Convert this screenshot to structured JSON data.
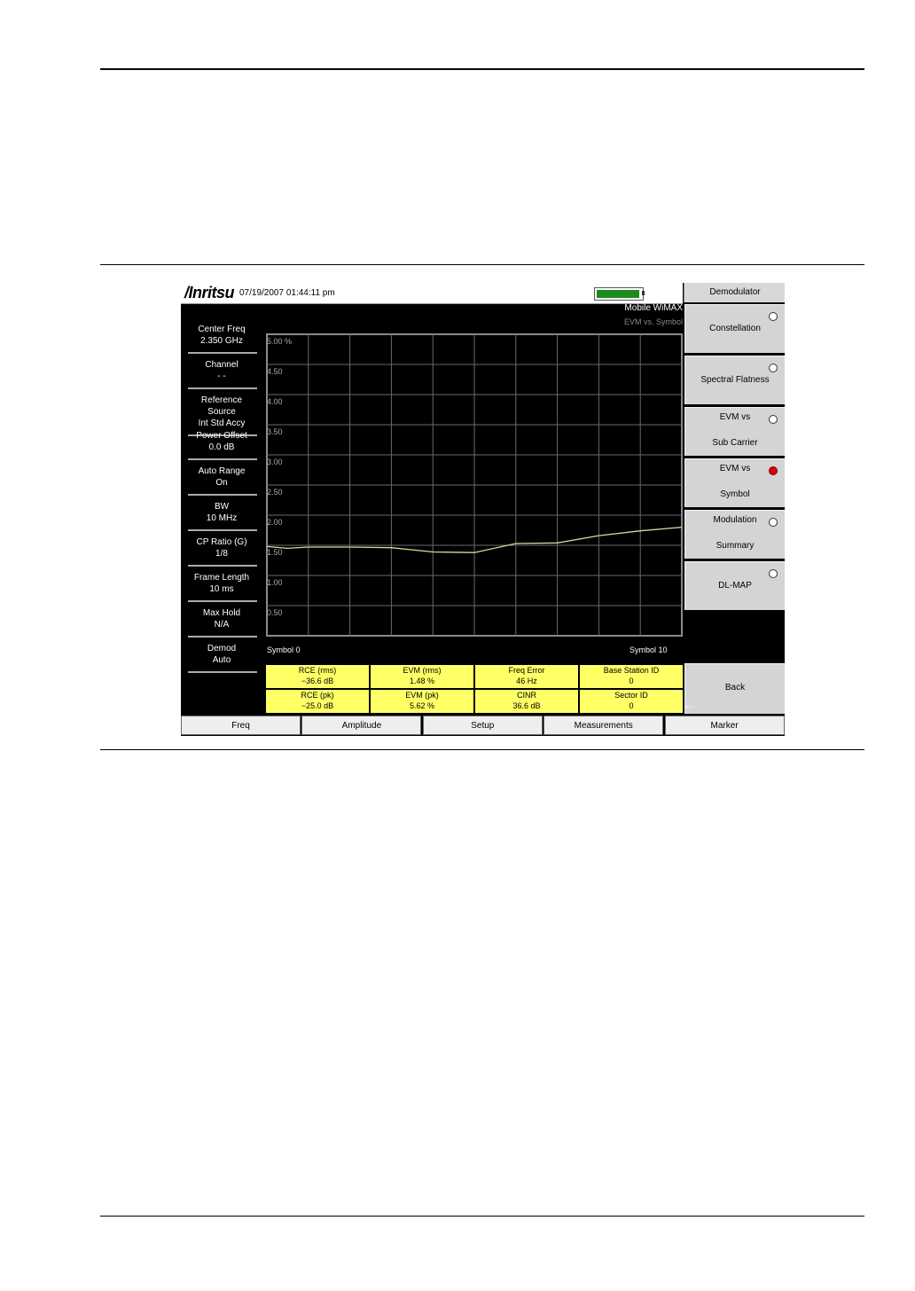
{
  "header": {
    "logo": "/Inritsu",
    "timestamp": "07/19/2007 01:44:11 pm",
    "battery_level": 0.95
  },
  "left_params": [
    {
      "label": "Center Freq",
      "value": "2.350 GHz"
    },
    {
      "label": "Channel",
      "value": "- -"
    },
    {
      "label": "Reference Source",
      "value": "Int Std Accy"
    },
    {
      "label": "Power Offset",
      "value": "0.0 dB"
    },
    {
      "label": "Auto Range",
      "value": "On"
    },
    {
      "label": "BW",
      "value": "10 MHz"
    },
    {
      "label": "CP Ratio (G)",
      "value": "1/8"
    },
    {
      "label": "Frame Length",
      "value": "10 ms"
    },
    {
      "label": "Max Hold",
      "value": "N/A"
    },
    {
      "label": "Demod",
      "value": "Auto"
    }
  ],
  "chart": {
    "title": "Mobile WiMAX",
    "subtitle": "EVM vs. Symbol",
    "x_start_label": "Symbol   0",
    "x_end_label": "Symbol   10"
  },
  "chart_data": {
    "type": "line",
    "title": "EVM vs. Symbol",
    "xlabel": "Symbol",
    "ylabel": "EVM (%)",
    "xlim": [
      0,
      10
    ],
    "ylim": [
      0,
      5.0
    ],
    "y_ticks": [
      "5.00 %",
      "4.50",
      "4.00",
      "3.50",
      "3.00",
      "2.50",
      "2.00",
      "1.50",
      "1.00",
      "0.50"
    ],
    "grid": true,
    "series": [
      {
        "color": "#d8d89a",
        "x": [
          0,
          0.5,
          1,
          2,
          3,
          4,
          5,
          6,
          7,
          8,
          9,
          10
        ],
        "values": [
          1.48,
          1.45,
          1.47,
          1.47,
          1.46,
          1.39,
          1.38,
          1.53,
          1.54,
          1.66,
          1.74,
          1.8
        ]
      }
    ]
  },
  "measurements": [
    {
      "label": "RCE (rms)",
      "value": "−36.6 dB"
    },
    {
      "label": "EVM (rms)",
      "value": "1.48  %"
    },
    {
      "label": "Freq Error",
      "value": "46 Hz"
    },
    {
      "label": "Base Station ID",
      "value": "0"
    },
    {
      "label": "RCE (pk)",
      "value": "−25.0 dB"
    },
    {
      "label": "EVM (pk)",
      "value": "5.62  %"
    },
    {
      "label": "CINR",
      "value": "36.6 dB"
    },
    {
      "label": "Sector ID",
      "value": "0"
    }
  ],
  "right_menu": {
    "title": "Demodulator",
    "keys": [
      {
        "line1": "Constellation",
        "line2": "",
        "selected": false
      },
      {
        "line1": "Spectral Flatness",
        "line2": "",
        "selected": false
      },
      {
        "line1": "EVM vs",
        "line2": "Sub Carrier",
        "selected": false
      },
      {
        "line1": "EVM vs",
        "line2": "Symbol",
        "selected": true
      },
      {
        "line1": "Modulation",
        "line2": "Summary",
        "selected": false
      },
      {
        "line1": "DL-MAP",
        "line2": "",
        "selected": false
      }
    ],
    "back_label": "Back",
    "back_arrow": "<--"
  },
  "bottom_tabs": [
    "Freq",
    "Amplitude",
    "Setup",
    "Measurements",
    "Marker"
  ]
}
